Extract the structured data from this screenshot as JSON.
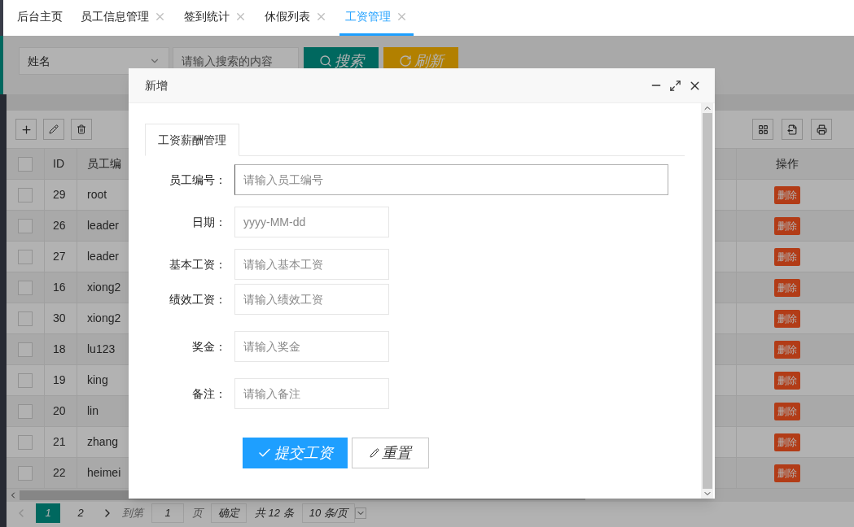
{
  "tabs": [
    {
      "label": "后台主页",
      "closable": false,
      "selected": false
    },
    {
      "label": "员工信息管理",
      "closable": true,
      "selected": false
    },
    {
      "label": "签到统计",
      "closable": true,
      "selected": false
    },
    {
      "label": "休假列表",
      "closable": true,
      "selected": false
    },
    {
      "label": "工资管理",
      "closable": true,
      "selected": true
    }
  ],
  "search": {
    "field": "姓名",
    "placeholder": "请输入搜索的内容",
    "buttons": [
      {
        "label": "搜索",
        "kind": "search"
      },
      {
        "label": "刷新",
        "kind": "refresh"
      }
    ]
  },
  "table": {
    "header_checked": false,
    "columns": [
      "ID",
      "员工编",
      "操作"
    ],
    "rows": [
      {
        "checked": false,
        "id": "29",
        "user": "root",
        "action": "删除"
      },
      {
        "checked": false,
        "id": "26",
        "user": "leader",
        "action": "删除"
      },
      {
        "checked": false,
        "id": "27",
        "user": "leader",
        "action": "删除"
      },
      {
        "checked": false,
        "id": "16",
        "user": "xiong2",
        "action": "删除"
      },
      {
        "checked": false,
        "id": "30",
        "user": "xiong2",
        "action": "删除"
      },
      {
        "checked": false,
        "id": "18",
        "user": "lu123",
        "action": "删除"
      },
      {
        "checked": false,
        "id": "19",
        "user": "king",
        "action": "删除"
      },
      {
        "checked": false,
        "id": "20",
        "user": "lin",
        "action": "删除"
      },
      {
        "checked": false,
        "id": "21",
        "user": "zhang",
        "action": "删除"
      },
      {
        "checked": false,
        "id": "22",
        "user": "heimei",
        "action": "删除"
      }
    ]
  },
  "pagination": {
    "pages": [
      {
        "label": "1",
        "selected": true
      },
      {
        "label": "2",
        "selected": false
      }
    ],
    "goto": "到第",
    "page_value": "1",
    "page_unit": "页",
    "confirm": "确定",
    "total": "共 12 条",
    "page_size": "10 条/页"
  },
  "dialog": {
    "title": "新增",
    "tabs": [
      {
        "label": "工资薪酬管理",
        "selected": true
      }
    ],
    "fields": [
      {
        "label": "员工编号：",
        "placeholder": "请输入员工编号",
        "kind": "wide",
        "focused": true
      },
      {
        "label": "日期：",
        "placeholder": "yyyy-MM-dd",
        "kind": "normal",
        "focused": false
      },
      {
        "label": "基本工资：",
        "placeholder": "请输入基本工资",
        "kind": "normal",
        "focused": false
      },
      {
        "label": "绩效工资：",
        "placeholder": "请输入绩效工资",
        "kind": "normal",
        "focused": false
      },
      {
        "label": "奖金：",
        "placeholder": "请输入奖金",
        "kind": "normal",
        "focused": false
      },
      {
        "label": "备注：",
        "placeholder": "请输入备注",
        "kind": "normal",
        "focused": false
      }
    ],
    "buttons": [
      {
        "label": "提交工资",
        "kind": "primary"
      },
      {
        "label": "重置",
        "kind": "secondary"
      }
    ]
  }
}
